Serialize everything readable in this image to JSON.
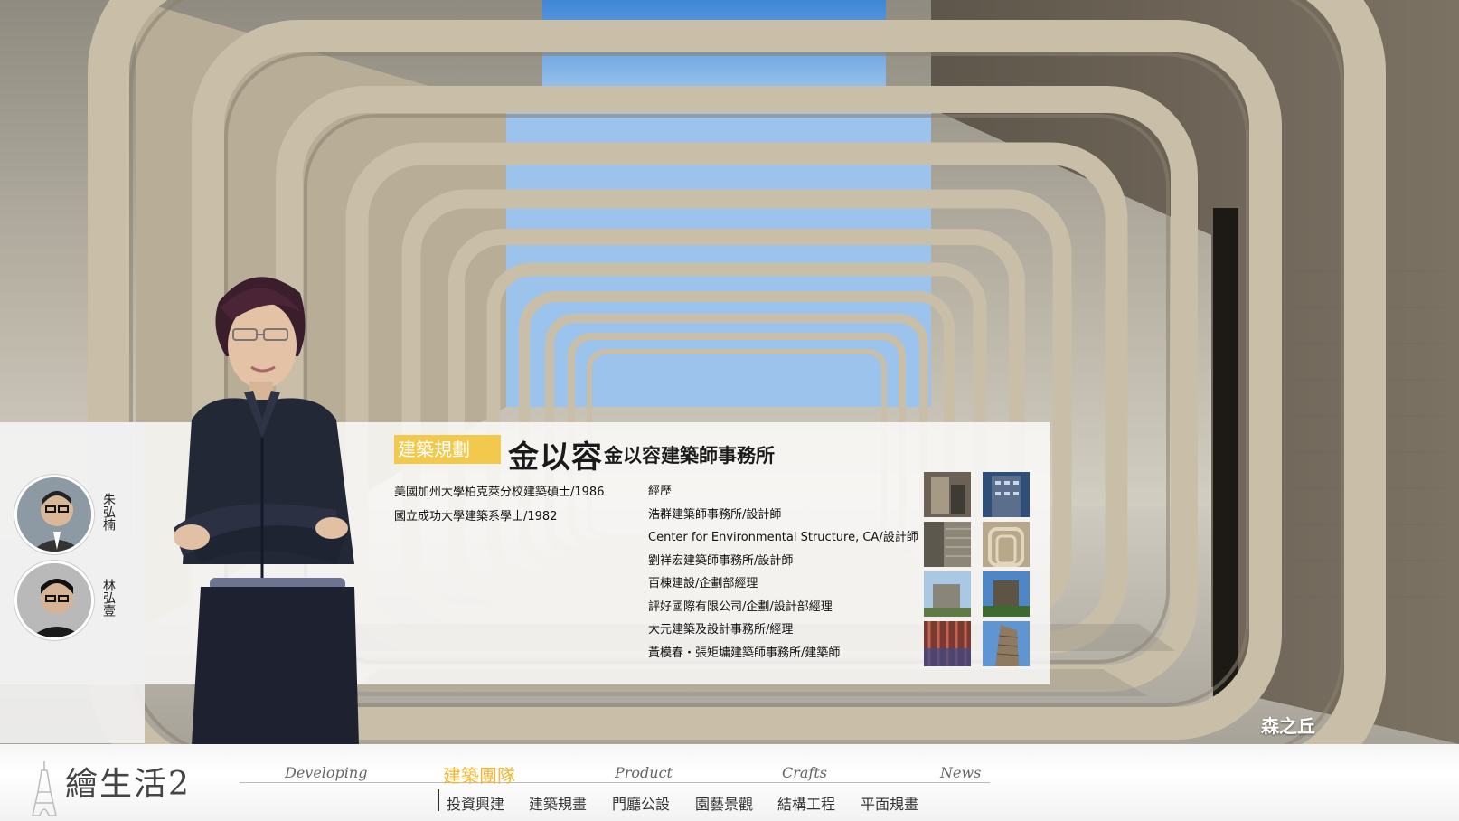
{
  "project_label": "森之丘",
  "profile": {
    "tag": "建築規劃",
    "name": "金以容",
    "firm": "金以容建築師事務所",
    "education": [
      "美國加州大學柏克萊分校建築碩士/1986",
      "國立成功大學建築系學士/1982"
    ],
    "experience_heading": "經歷",
    "experience": [
      "浩群建築師事務所/設計師",
      "Center for Environmental Structure, CA/設計師",
      "劉祥宏建築師事務所/設計師",
      "百棟建設/企劃部經理",
      "評好國際有限公司/企劃/設計部經理",
      "大元建築及設計事務所/經理",
      "黃模春・張矩墉建築師事務所/建築師"
    ]
  },
  "team": [
    {
      "name": "朱弘楠"
    },
    {
      "name": "林弘壹"
    }
  ],
  "nav": {
    "logo": "繪生活2",
    "items": [
      {
        "label": "Developing",
        "active": false
      },
      {
        "label": "建築團隊",
        "active": true
      },
      {
        "label": "Product",
        "active": false
      },
      {
        "label": "Crafts",
        "active": false
      },
      {
        "label": "News",
        "active": false
      }
    ],
    "subnav": [
      "投資興建",
      "建築規畫",
      "門廳公設",
      "園藝景觀",
      "結構工程",
      "平面規畫"
    ]
  },
  "colors": {
    "accent": "#f2c94c",
    "nav_active": "#f2b632"
  }
}
